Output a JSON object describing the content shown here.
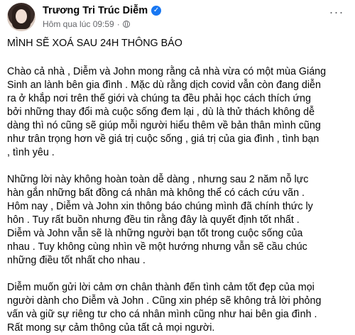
{
  "post": {
    "author_name": "Trương Tri Trúc Diễm",
    "timestamp": "Hôm qua lúc 09:59",
    "separator": "·",
    "more_label": "···",
    "paragraphs": [
      "MÌNH SẼ XOÁ SAU 24H THÔNG BÁO",
      "Chào cả nhà , Diễm và John mong rằng cả nhà vừa có một mùa Giáng\nSinh an lành bên gia đình . Mặc dù rằng dịch covid vẫn còn đang diễn\nra ở khắp nơi trên thế giới và chúng ta đều phải học cách thích ứng\nbởi những thay đổi mà cuộc sống đem lại , dù là thử thách không dễ\ndàng thì nó cũng sẽ giúp mỗi người hiểu thêm về bản thân mình cũng\nnhư trân trọng hơn về giá trị cuộc sống , giá trị của gia đình , tình bạn\n, tình yêu .",
      "Những lời này không hoàn toàn dễ dàng , nhưng sau 2 năm nỗ lực\nhàn gắn những bất đồng cá nhân mà không thể có cách cứu vãn .\nHôm nay , Diễm và John xin  thông báo chúng mình đã chính thức ly\nhôn .  Tuy rất buồn nhưng đều tin rằng đây là quyết định tốt nhất .\nDiễm và John vẫn sẽ là những người bạn tốt trong cuộc sống của\nnhau . Tuy không cùng nhìn về một hướng nhưng vẫn sẽ cầu chúc\nnhững điều tốt nhất cho nhau .",
      "Diễm muốn gửi lời cảm ơn chân thành đến tình cảm tốt đẹp của mọi\nngười dành cho Diễm và John . Cũng xin phép sẽ không trả lời phỏng\nvấn và giữ sự riêng tư cho cá nhân mình cũng như hai bên gia đình .\nRất mong sự cảm thông của tất cả mọi người."
    ]
  },
  "icons": {
    "verified": "verified-badge-icon",
    "privacy": "globe-icon",
    "more": "more-horizontal-icon"
  },
  "colors": {
    "verified": "#1877f2",
    "meta_text": "#65676b",
    "body_text": "#050505"
  }
}
